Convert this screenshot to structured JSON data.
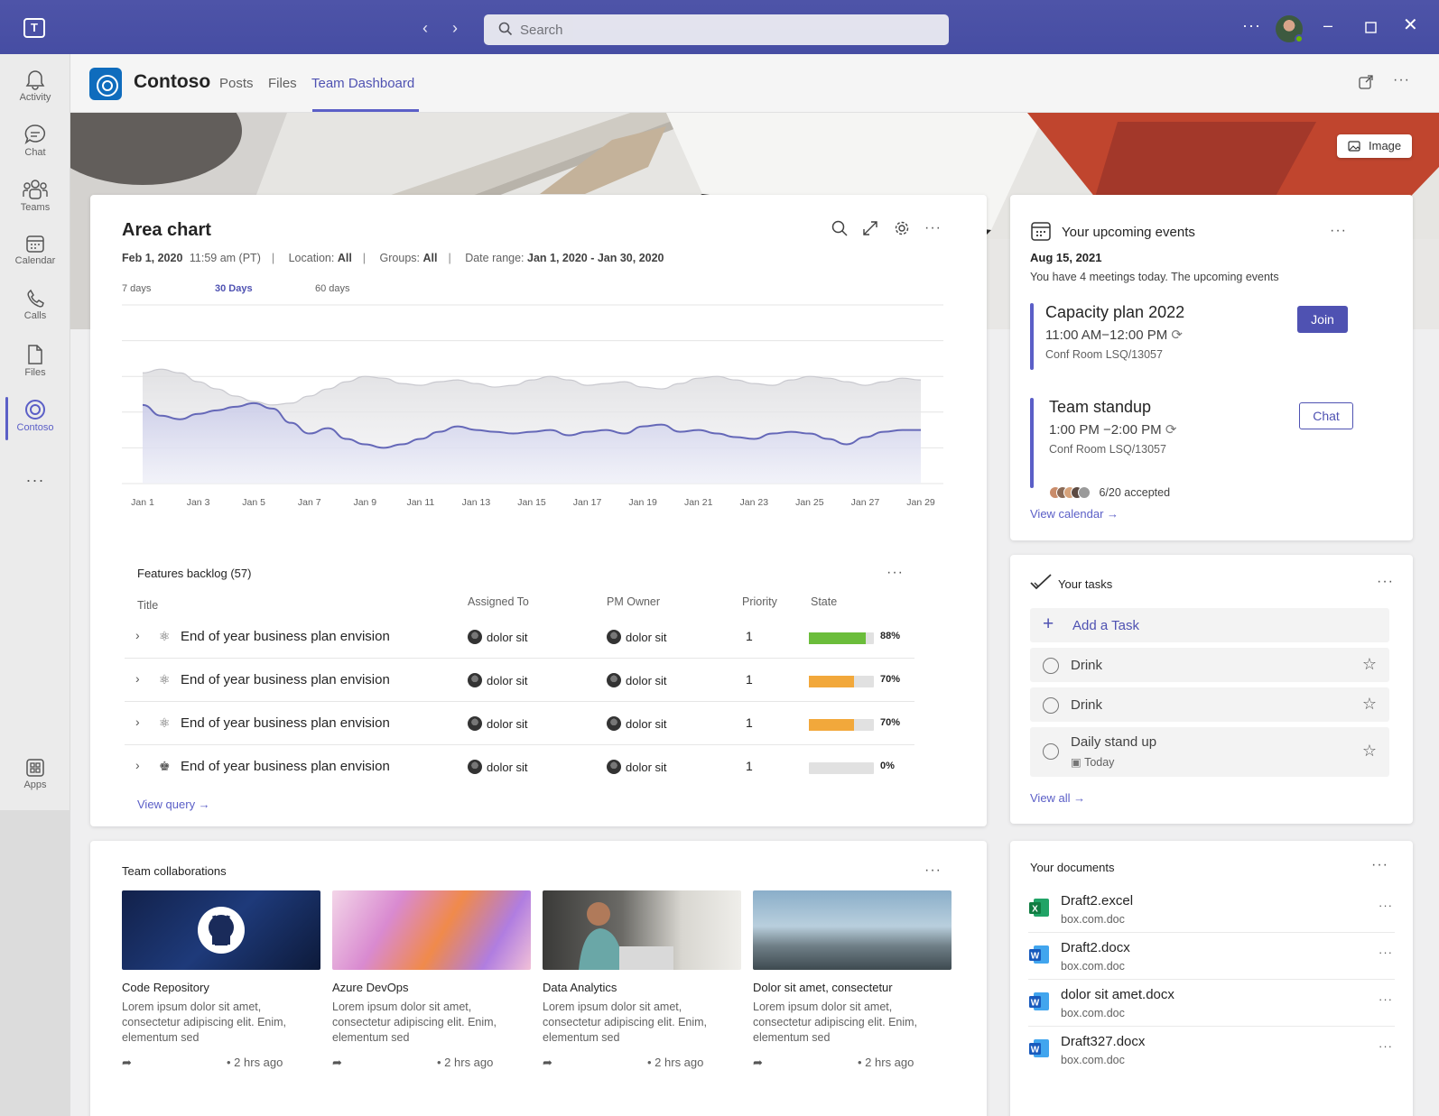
{
  "titlebar": {
    "search_placeholder": "Search",
    "logo_letter": "T"
  },
  "rail": {
    "items": [
      {
        "label": "Activity",
        "icon": "bell-icon"
      },
      {
        "label": "Chat",
        "icon": "chat-icon"
      },
      {
        "label": "Teams",
        "icon": "teams-icon"
      },
      {
        "label": "Calendar",
        "icon": "calendar-icon"
      },
      {
        "label": "Calls",
        "icon": "phone-icon"
      },
      {
        "label": "Files",
        "icon": "file-icon"
      },
      {
        "label": "Contoso",
        "icon": "contoso-icon"
      },
      {
        "label": "Apps",
        "icon": "apps-icon"
      }
    ],
    "more": "···"
  },
  "header": {
    "app_name": "Contoso",
    "tabs": [
      {
        "label": "Posts"
      },
      {
        "label": "Files"
      },
      {
        "label": "Team Dashboard"
      }
    ],
    "active_tab": "Team Dashboard"
  },
  "banner": {
    "chip_label": "Image"
  },
  "area_chart_card": {
    "title": "Area chart",
    "meta": {
      "date": "Feb 1, 2020",
      "time": "11:59 am (PT)",
      "location_label": "Location:",
      "location_value": "All",
      "groups_label": "Groups:",
      "groups_value": "All",
      "range_label": "Date range:",
      "range_value": "Jan 1, 2020 - Jan 30, 2020"
    },
    "range_tabs": [
      {
        "label": "7 days"
      },
      {
        "label": "30 Days"
      },
      {
        "label": "60 days"
      }
    ],
    "active_range": "30 Days"
  },
  "chart_data": {
    "type": "area",
    "x_tick_labels": [
      "Jan 1",
      "Jan 3",
      "Jan 5",
      "Jan 7",
      "Jan 9",
      "Jan 11",
      "Jan 13",
      "Jan 15",
      "Jan 17",
      "Jan 19",
      "Jan 21",
      "Jan 23",
      "Jan 25",
      "Jan 27",
      "Jan 29"
    ],
    "series": [
      {
        "color": "#6568b8",
        "values": [
          44,
          38,
          36,
          39,
          41,
          43,
          45,
          42,
          34,
          28,
          31,
          25,
          22,
          20,
          22,
          25,
          29,
          32,
          30,
          29,
          28,
          29,
          30,
          27,
          29,
          30,
          28,
          32,
          33,
          29,
          30,
          28,
          26,
          25,
          28,
          29,
          28,
          25,
          22,
          26,
          29,
          30,
          30
        ]
      },
      {
        "color": "#c9c9cf",
        "values": [
          62,
          64,
          62,
          57,
          53,
          49,
          46,
          44,
          45,
          49,
          53,
          57,
          60,
          59,
          56,
          55,
          57,
          58,
          56,
          54,
          55,
          58,
          60,
          58,
          55,
          56,
          57,
          54,
          53,
          56,
          59,
          60,
          58,
          56,
          55,
          58,
          60,
          59,
          57,
          55,
          57,
          59,
          58
        ]
      }
    ],
    "ylim": [
      0,
      100
    ],
    "grid": true,
    "legend": "none"
  },
  "backlog": {
    "title": "Features backlog (57)",
    "columns": [
      "Title",
      "Assigned To",
      "PM Owner",
      "Priority",
      "State"
    ],
    "rows": [
      {
        "title": "End of year business plan envision",
        "assigned": "dolor sit",
        "owner": "dolor sit",
        "priority": "1",
        "progress": 88,
        "progress_label": "88%",
        "color": "#6bbd3b"
      },
      {
        "title": "End of year business plan envision",
        "assigned": "dolor sit",
        "owner": "dolor sit",
        "priority": "1",
        "progress": 70,
        "progress_label": "70%",
        "color": "#f2a83b"
      },
      {
        "title": "End of year business plan envision",
        "assigned": "dolor sit",
        "owner": "dolor sit",
        "priority": "1",
        "progress": 70,
        "progress_label": "70%",
        "color": "#f2a83b"
      },
      {
        "title": "End of year business plan envision",
        "assigned": "dolor sit",
        "owner": "dolor sit",
        "priority": "1",
        "progress": 0,
        "progress_label": "0%",
        "color": "#d1d1d1"
      }
    ],
    "view_query": "View query →"
  },
  "events": {
    "title": "Your upcoming events",
    "date": "Aug 15, 2021",
    "subtitle": "You have 4 meetings today. The upcoming events",
    "items": [
      {
        "title": "Capacity plan 2022",
        "time": "11:00 AM−12:00 PM",
        "room": "Conf Room LSQ/13057",
        "action": "Join"
      },
      {
        "title": "Team standup",
        "time": "1:00 PM −2:00 PM",
        "room": "Conf Room LSQ/13057",
        "action": "Chat",
        "accepted": "6/20 accepted"
      }
    ],
    "view_calendar": "View calendar →"
  },
  "tasks": {
    "title": "Your tasks",
    "add_label": "Add a Task",
    "items": [
      {
        "label": "Drink"
      },
      {
        "label": "Drink"
      },
      {
        "label": "Daily stand up",
        "due": "Today"
      }
    ],
    "view_all": "View all →"
  },
  "collab": {
    "title": "Team collaborations",
    "items": [
      {
        "title": "Code Repository",
        "desc": "Lorem ipsum dolor sit amet, consectetur adipiscing elit. Enim, elementum sed",
        "ago": "• 2 hrs ago"
      },
      {
        "title": "Azure DevOps",
        "desc": "Lorem ipsum dolor sit amet, consectetur adipiscing elit. Enim, elementum sed",
        "ago": "• 2 hrs ago"
      },
      {
        "title": "Data Analytics",
        "desc": "Lorem ipsum dolor sit amet, consectetur adipiscing elit. Enim, elementum sed",
        "ago": "• 2 hrs ago"
      },
      {
        "title": "Dolor sit amet, consectetur",
        "desc": "Lorem ipsum dolor sit amet, consectetur adipiscing elit. Enim, elementum sed",
        "ago": "• 2 hrs ago"
      }
    ]
  },
  "documents": {
    "title": "Your documents",
    "items": [
      {
        "name": "Draft2.excel",
        "source": "box.com.doc",
        "type": "excel"
      },
      {
        "name": "Draft2.docx",
        "source": "box.com.doc",
        "type": "word"
      },
      {
        "name": "dolor sit amet.docx",
        "source": "box.com.doc",
        "type": "word"
      },
      {
        "name": "Draft327.docx",
        "source": "box.com.doc",
        "type": "word"
      }
    ]
  },
  "colors": {
    "brand": "#464da3",
    "accent": "#5b5fc7",
    "link": "#5b5fc7"
  }
}
